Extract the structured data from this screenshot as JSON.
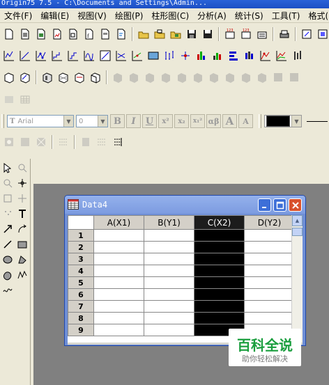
{
  "app": {
    "title_text": "Origin75 7.5 - C:\\Documents and Settings\\Admin..."
  },
  "menu": {
    "items": [
      "文件(F)",
      "编辑(E)",
      "视图(V)",
      "绘图(P)",
      "柱形图(C)",
      "分析(A)",
      "统计(S)",
      "工具(T)",
      "格式("
    ]
  },
  "format_bar": {
    "font_name": "Arial",
    "font_size": "0",
    "bold": "B",
    "italic": "I",
    "underline": "U",
    "superscript": "x²",
    "subscript": "x₂",
    "supersub": "x₁²",
    "greek": "αβ",
    "grow_font": "A",
    "shrink_font": "A"
  },
  "data_window": {
    "title": "Data4",
    "columns": [
      "A(X1)",
      "B(Y1)",
      "C(X2)",
      "D(Y2)"
    ],
    "selected_column_index": 2,
    "rows": [
      "1",
      "2",
      "3",
      "4",
      "5",
      "6",
      "7",
      "8",
      "9"
    ]
  },
  "watermark": {
    "title": "百科全说",
    "subtitle": "助你轻松解决"
  },
  "colors": {
    "accent_blue": "#2a63d8",
    "window_frame": "#6f8fd6",
    "watermark_green": "#1a9e3e",
    "selected_col": "#000000"
  }
}
